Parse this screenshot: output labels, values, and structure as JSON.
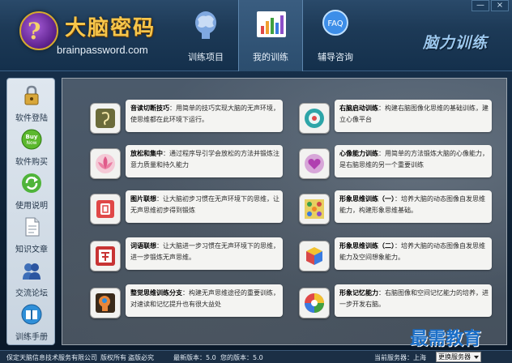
{
  "window": {
    "minimize_label": "—",
    "close_label": "×"
  },
  "brand": {
    "logo_glyph": "?",
    "title": "大脑密码",
    "url": "brainpassword.com",
    "slogan": "脑力训练"
  },
  "nav": [
    {
      "label": "训练项目",
      "icon": "brain-head-icon"
    },
    {
      "label": "我的训练",
      "icon": "bar-chart-icon"
    },
    {
      "label": "辅导咨询",
      "icon": "faq-icon",
      "glyph": "FAQ"
    }
  ],
  "sidebar": [
    {
      "label": "软件登陆",
      "icon": "lock-icon"
    },
    {
      "label": "软件购买",
      "icon": "buy-now-icon",
      "glyph_top": "Buy",
      "glyph_bottom": "Now"
    },
    {
      "label": "使用说明",
      "icon": "refresh-icon"
    },
    {
      "label": "知识文章",
      "icon": "document-icon"
    },
    {
      "label": "交流论坛",
      "icon": "users-icon"
    },
    {
      "label": "训练手册",
      "icon": "manual-book-icon"
    }
  ],
  "trainings": [
    {
      "title": "音读切断技巧",
      "desc": "：用简单的技巧实现大脑的无声环境，使思维都在此环境下运行。",
      "icon": "ear-sound-icon"
    },
    {
      "title": "右脑启动训练",
      "desc": "：构建右脑图像化思维的基础训练，建立心像平台",
      "icon": "right-brain-icon"
    },
    {
      "title": "放松和集中",
      "desc": "：通过程序导引学会放松的方法并锻炼注意力质量和持久能力",
      "icon": "lotus-icon"
    },
    {
      "title": "心像能力训练",
      "desc": "：用简单的方法锻炼大脑的心像能力，是右脑思维的另一个重要训练",
      "icon": "heart-flower-icon"
    },
    {
      "title": "图片联想",
      "desc": "：让大脑初步习惯在无声环境下的思维，让无声思维初步得到锻炼",
      "icon": "picture-frame-icon"
    },
    {
      "title": "形象思维训练（一）",
      "desc": "：培养大脑的动态图像自发思维能力，构建形象思维基础。",
      "icon": "grid-pattern-icon"
    },
    {
      "title": "词语联想",
      "desc": "：让大脑进一步习惯在无声环境下的思维，进一步锻炼无声思维。",
      "icon": "word-character-icon"
    },
    {
      "title": "形象思维训练（二）",
      "desc": "：培养大脑的动态图像自发思维能力及空间想象能力。",
      "icon": "cube-icon"
    },
    {
      "title": "整觉思维训练分支",
      "desc": "：构建无声思维途径的重要训练，对速读和记忆提升也有很大益处",
      "icon": "head-thinking-icon"
    },
    {
      "title": "形象记忆能力",
      "desc": "：右脑图像和空间记忆能力的培养，进一步开发右脑。",
      "icon": "color-wheel-icon"
    }
  ],
  "status": {
    "company": "保定天脑信息技术服务有限公司",
    "rights": "版权所有",
    "piracy": "盗版必究",
    "latest_version": "最新版本：5.0",
    "current_version": "您的版本：5.0",
    "server_label": "当前服务器：",
    "server_value": "上海",
    "server_select": "更换服务器"
  },
  "watermark": "最需教育",
  "colors": {
    "brand_gold": "#f7c64b",
    "slogan_blue": "#9cc8ee",
    "watermark_blue": "#1b6fc8"
  }
}
